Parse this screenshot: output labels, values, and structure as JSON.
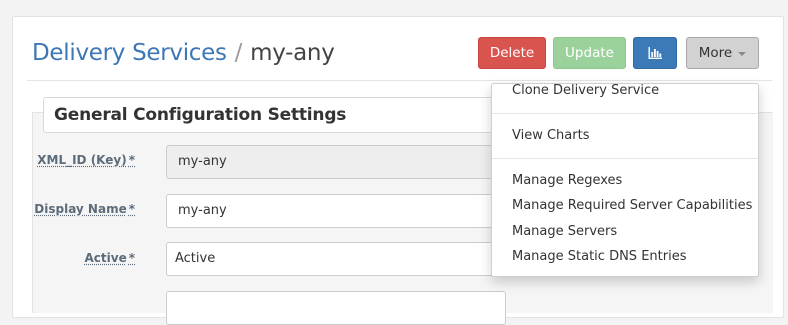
{
  "breadcrumb": {
    "parent": "Delivery Services",
    "separator": "/",
    "current": "my-any"
  },
  "toolbar": {
    "delete_label": "Delete",
    "update_label": "Update",
    "charts_icon": "bar-chart-icon",
    "more_label": "More"
  },
  "form": {
    "section_title": "General Configuration Settings",
    "required_marker": "*",
    "fields": [
      {
        "label": "XML_ID (Key)",
        "value": "my-any"
      },
      {
        "label": "Display Name",
        "value": "my-any"
      },
      {
        "label": "Active",
        "value": "Active"
      }
    ]
  },
  "more_menu": {
    "items": [
      "Clone Delivery Service",
      "View Charts",
      "Manage Regexes",
      "Manage Required Server Capabilities",
      "Manage Servers",
      "Manage Static DNS Entries"
    ]
  },
  "colors": {
    "link": "#3d77b5",
    "danger": "#d9534f",
    "success_disabled": "#9bd29b",
    "primary": "#3c7ab7",
    "default_active": "#d2d2d2"
  }
}
